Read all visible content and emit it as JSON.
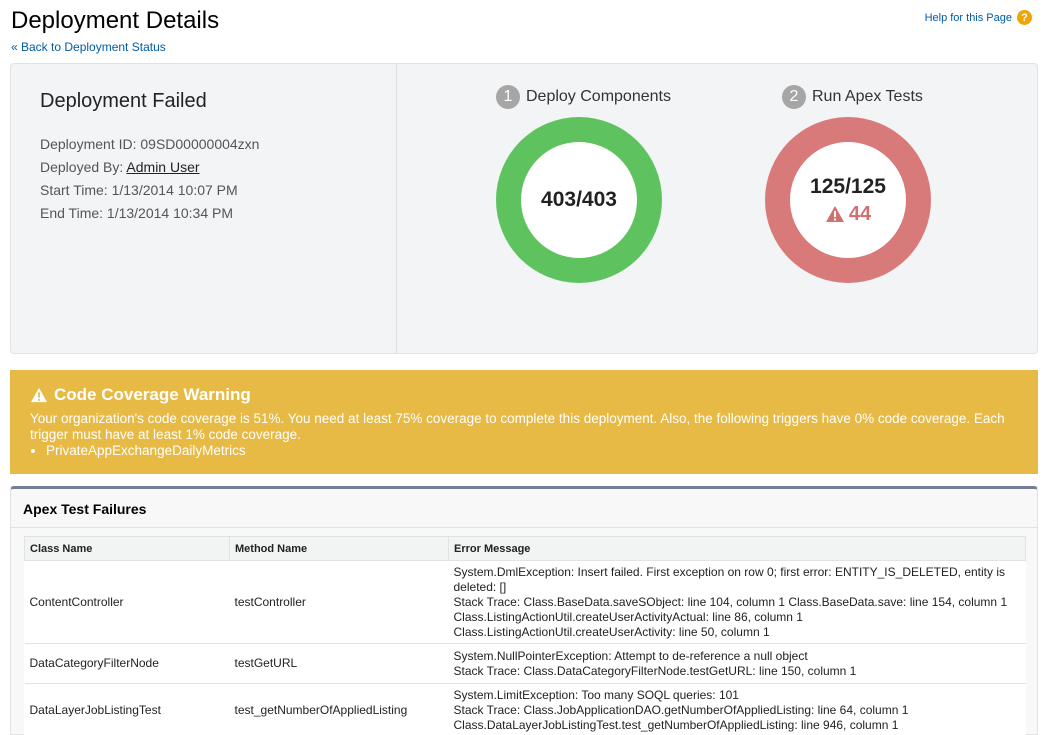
{
  "header": {
    "title": "Deployment Details",
    "back_link": "« Back to Deployment Status",
    "help_link": "Help for this Page",
    "help_icon": "question-icon"
  },
  "summary": {
    "status_title": "Deployment Failed",
    "deployment_id_label": "Deployment ID:",
    "deployment_id": "09SD00000004zxn",
    "deployed_by_label": "Deployed By:",
    "deployed_by": "Admin User",
    "start_time_label": "Start Time:",
    "start_time": "1/13/2014 10:07 PM",
    "end_time_label": "End Time:",
    "end_time": "1/13/2014 10:34 PM"
  },
  "steps": [
    {
      "number": "1",
      "label": "Deploy Components",
      "value": "403/403",
      "color": "#5ec35e"
    },
    {
      "number": "2",
      "label": "Run Apex Tests",
      "value": "125/125",
      "failures": "44",
      "color": "#d97a7a",
      "failure_icon": "warning-triangle-icon"
    }
  ],
  "warning": {
    "title": "Code Coverage Warning",
    "icon": "warning-triangle-icon",
    "message": "Your organization's code coverage is 51%. You need at least 75% coverage to complete this deployment. Also, the following triggers have 0% code coverage. Each trigger must have at least 1% code coverage.",
    "items": [
      "PrivateAppExchangeDailyMetrics"
    ],
    "color": "#e7b945"
  },
  "failures": {
    "title": "Apex Test Failures",
    "columns": [
      "Class Name",
      "Method Name",
      "Error Message"
    ],
    "rows": [
      {
        "class_name": "ContentController",
        "method_name": "testController",
        "error": "System.DmlException: Insert failed. First exception on row 0; first error: ENTITY_IS_DELETED, entity is deleted: []\nStack Trace: Class.BaseData.saveSObject: line 104, column 1 Class.BaseData.save: line 154, column 1\nClass.ListingActionUtil.createUserActivityActual: line 86, column 1\nClass.ListingActionUtil.createUserActivity: line 50, column 1"
      },
      {
        "class_name": "DataCategoryFilterNode",
        "method_name": "testGetURL",
        "error": "System.NullPointerException: Attempt to de-reference a null object\nStack Trace: Class.DataCategoryFilterNode.testGetURL: line 150, column 1"
      },
      {
        "class_name": "DataLayerJobListingTest",
        "method_name": "test_getNumberOfAppliedListing",
        "error": "System.LimitException: Too many SOQL queries: 101\nStack Trace: Class.JobApplicationDAO.getNumberOfAppliedListing: line 64, column 1\nClass.DataLayerJobListingTest.test_getNumberOfAppliedListing: line 946, column 1"
      }
    ]
  }
}
